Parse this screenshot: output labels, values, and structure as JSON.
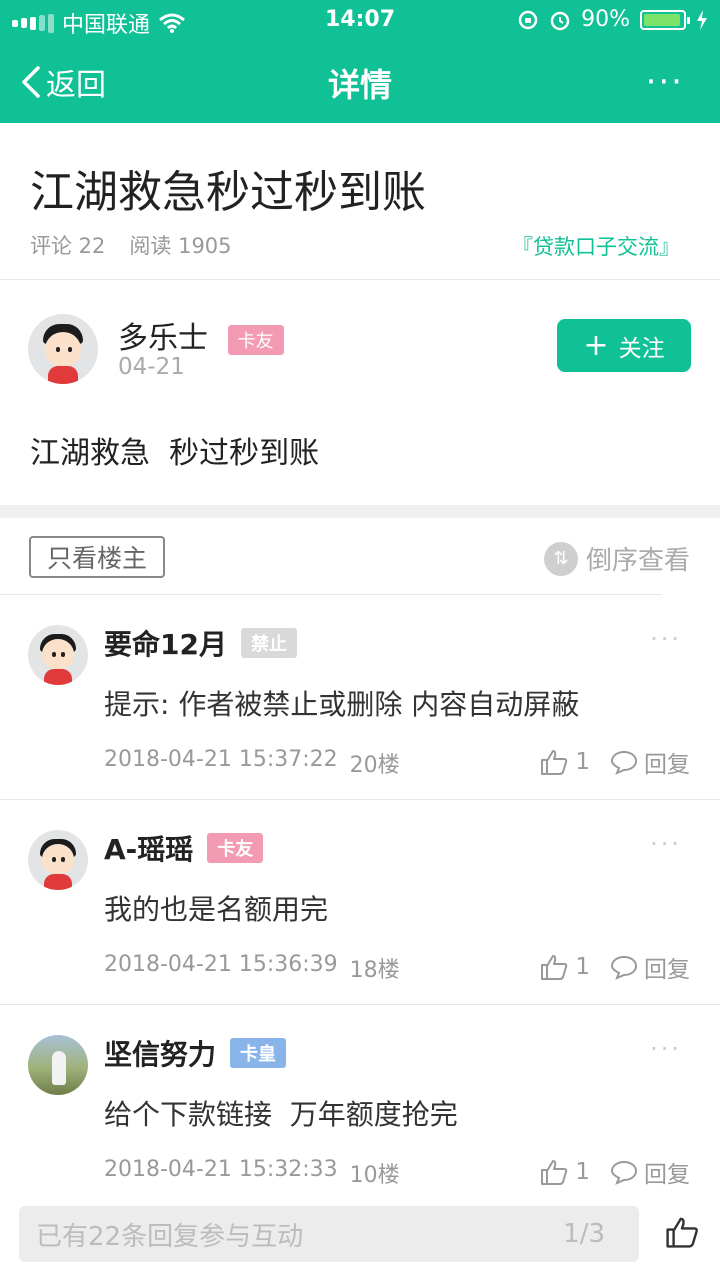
{
  "status_bar": {
    "carrier": "中国联通",
    "time": "14:07",
    "battery": "90%"
  },
  "nav": {
    "back_label": "返回",
    "title": "详情",
    "more": "···"
  },
  "article": {
    "title": "江湖救急秒过秒到账",
    "comments": "评论 22",
    "reads": "阅读 1905",
    "topic": "『贷款口子交流』"
  },
  "author": {
    "name": "多乐士",
    "badge": "卡友",
    "date": "04-21",
    "follow_label": "关注",
    "follow_plus": "+"
  },
  "post": {
    "content": "江湖救急  秒过秒到账"
  },
  "filter": {
    "only_owner": "只看楼主",
    "reverse": "倒序查看"
  },
  "comments": [
    {
      "name": "要命12月",
      "badge": "禁止",
      "badge_color": "#d9d9d9",
      "text": "提示: 作者被禁止或删除 内容自动屏蔽",
      "datetime": "2018-04-21 15:37:22",
      "floor": "20楼",
      "likes": "1",
      "reply": "回复"
    },
    {
      "name": "A-瑶瑶",
      "badge": "卡友",
      "badge_color": "#f39bb2",
      "text": "我的也是名额用完",
      "datetime": "2018-04-21 15:36:39",
      "floor": "18楼",
      "likes": "1",
      "reply": "回复"
    },
    {
      "name": "坚信努力",
      "badge": "卡皇",
      "badge_color": "#88b4ea",
      "text": "给个下款链接  万年额度抢完",
      "datetime": "2018-04-21 15:32:33",
      "floor": "10楼",
      "likes": "1",
      "reply": "回复"
    }
  ],
  "bottom": {
    "placeholder": "已有22条回复参与互动",
    "page": "1/3"
  },
  "colors": {
    "accent": "#10c195",
    "badge_pink": "#f39bb2",
    "badge_blue": "#88b4ea"
  }
}
